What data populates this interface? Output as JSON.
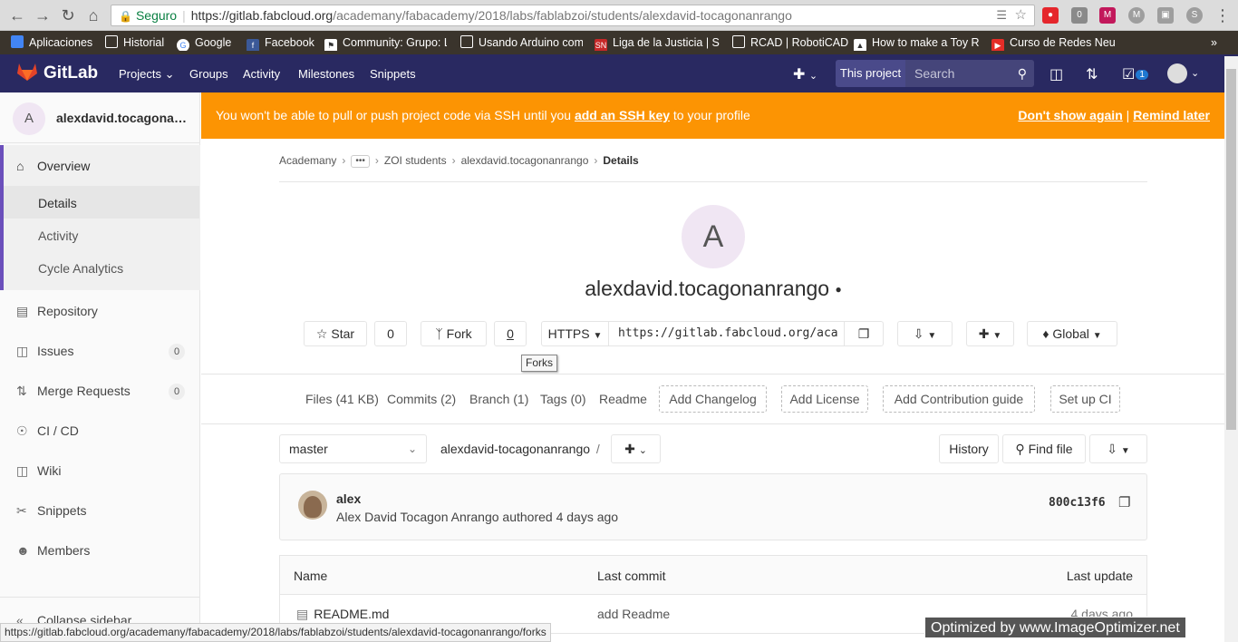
{
  "browser": {
    "secure_label": "Seguro",
    "url_host": "https://gitlab.fabcloud.org",
    "url_path": "/academany/fabacademy/2018/labs/fablabzoi/students/alexdavid-tocagonanrango",
    "bookmarks": [
      {
        "label": "Aplicaciones",
        "icon": "apps-icon"
      },
      {
        "label": "Historial",
        "icon": "history-icon"
      },
      {
        "label": "Google",
        "icon": "google-icon"
      },
      {
        "label": "Facebook",
        "icon": "facebook-icon"
      },
      {
        "label": "Community: Grupo: L",
        "icon": "community-icon"
      },
      {
        "label": "Usando Arduino com",
        "icon": "page-icon"
      },
      {
        "label": "Liga de la Justicia | Se",
        "icon": "sn-icon"
      },
      {
        "label": "RCAD | RobotiCAD",
        "icon": "page-icon"
      },
      {
        "label": "How to make a Toy R",
        "icon": "toy-icon"
      },
      {
        "label": "Curso de Redes Neur",
        "icon": "youtube-icon"
      }
    ],
    "more_bookmarks": "»",
    "ext_badge": "0"
  },
  "gitlab_nav": {
    "logo": "GitLab",
    "links": [
      "Projects",
      "Groups",
      "Activity",
      "Milestones",
      "Snippets"
    ],
    "this_project": "This project",
    "search_placeholder": "Search",
    "todos_count": "1"
  },
  "sidebar": {
    "avatar_letter": "A",
    "project_name": "alexdavid.tocagonan...",
    "overview": "Overview",
    "sub": [
      "Details",
      "Activity",
      "Cycle Analytics"
    ],
    "items": [
      {
        "label": "Repository",
        "icon": "book-icon"
      },
      {
        "label": "Issues",
        "icon": "issues-icon",
        "count": "0"
      },
      {
        "label": "Merge Requests",
        "icon": "merge-icon",
        "count": "0"
      },
      {
        "label": "CI / CD",
        "icon": "rocket-icon"
      },
      {
        "label": "Wiki",
        "icon": "wiki-icon"
      },
      {
        "label": "Snippets",
        "icon": "scissors-icon"
      },
      {
        "label": "Members",
        "icon": "users-icon"
      }
    ],
    "collapse": "Collapse sidebar"
  },
  "banner": {
    "text_before": "You won't be able to pull or push project code via SSH until you",
    "link": "add an SSH key",
    "text_after": "to your profile",
    "dont_show": "Don't show again",
    "divider": "|",
    "remind": "Remind later"
  },
  "breadcrumb": [
    "Academany",
    "ZOI students",
    "alexdavid.tocagonanrango",
    "Details"
  ],
  "project": {
    "avatar_letter": "A",
    "title": "alexdavid.tocagonanrango",
    "star_label": "Star",
    "star_count": "0",
    "fork_label": "Fork",
    "fork_count": "0",
    "clone_protocol": "HTTPS",
    "clone_url": "https://gitlab.fabcloud.org/aca",
    "notification": "Global",
    "tooltip": "Forks"
  },
  "stats": {
    "files": "Files (41 KB)",
    "commits": "Commits (2)",
    "branch": "Branch (1)",
    "tags": "Tags (0)",
    "readme": "Readme",
    "add_changelog": "Add Changelog",
    "add_license": "Add License",
    "add_contrib": "Add Contribution guide",
    "setup_ci": "Set up CI"
  },
  "repo": {
    "branch": "master",
    "path": "alexdavid-tocagonanrango",
    "path_sep": "/",
    "history": "History",
    "find_file": "Find file"
  },
  "commit": {
    "author": "alex",
    "desc": "Alex David Tocagon Anrango authored 4 days ago",
    "sha": "800c13f6"
  },
  "table": {
    "headers": [
      "Name",
      "Last commit",
      "Last update"
    ],
    "rows": [
      {
        "name": "README.md",
        "commit": "add Readme",
        "updated": "4 days ago"
      }
    ]
  },
  "status_url": "https://gitlab.fabcloud.org/academany/fabacademy/2018/labs/fablabzoi/students/alexdavid-tocagonanrango/forks",
  "watermark": "Optimized by www.ImageOptimizer.net"
}
